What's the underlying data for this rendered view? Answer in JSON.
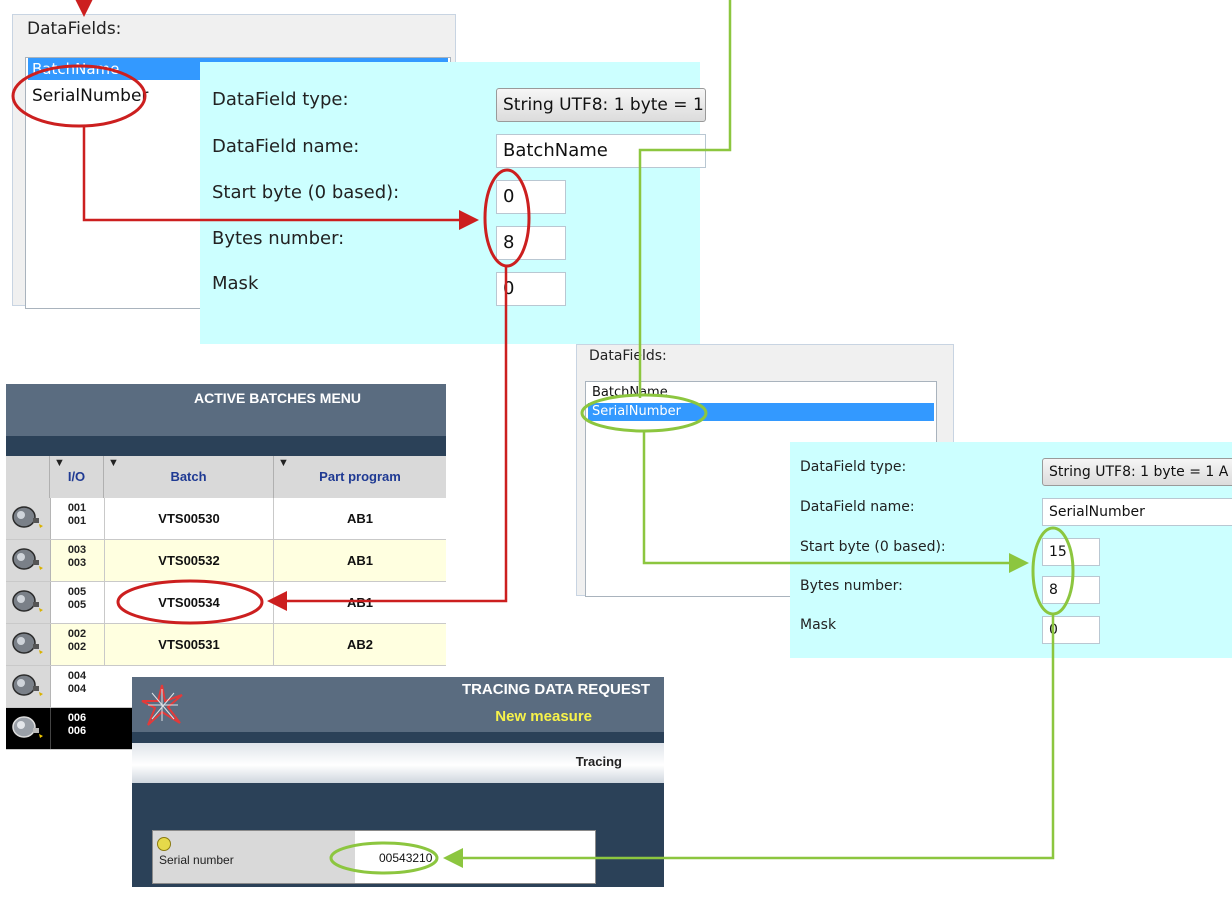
{
  "panel_top": {
    "group_title": "DataFields:",
    "list_items": [
      "BatchName",
      "SerialNumber"
    ],
    "selected_index": 0,
    "labels": {
      "type": "DataField type:",
      "name": "DataField name:",
      "start": "Start byte (0 based):",
      "bytes": "Bytes number:",
      "mask": "Mask"
    },
    "values": {
      "type": "String UTF8: 1 byte = 1",
      "name": "BatchName",
      "start": "0",
      "bytes": "8",
      "mask": "0"
    }
  },
  "panel_right": {
    "group_title": "DataFields:",
    "list_items": [
      "BatchName",
      "SerialNumber"
    ],
    "selected_index": 1,
    "labels": {
      "type": "DataField type:",
      "name": "DataField name:",
      "start": "Start byte (0 based):",
      "bytes": "Bytes number:",
      "mask": "Mask"
    },
    "values": {
      "type": "String UTF8: 1 byte = 1 A",
      "name": "SerialNumber",
      "start": "15",
      "bytes": "8",
      "mask": "0"
    }
  },
  "batches_menu": {
    "title": "ACTIVE BATCHES MENU",
    "columns": {
      "io": "I/O",
      "batch": "Batch",
      "program": "Part program"
    },
    "rows": [
      {
        "io_top": "001",
        "io_bottom": "001",
        "batch": "VTS00530",
        "program": "AB1"
      },
      {
        "io_top": "003",
        "io_bottom": "003",
        "batch": "VTS00532",
        "program": "AB1"
      },
      {
        "io_top": "005",
        "io_bottom": "005",
        "batch": "VTS00534",
        "program": "AB1"
      },
      {
        "io_top": "002",
        "io_bottom": "002",
        "batch": "VTS00531",
        "program": "AB2"
      },
      {
        "io_top": "004",
        "io_bottom": "004",
        "batch": "",
        "program": ""
      },
      {
        "io_top": "006",
        "io_bottom": "006",
        "batch": "",
        "program": ""
      }
    ]
  },
  "tracing": {
    "title": "TRACING DATA REQUEST",
    "subtitle": "New measure",
    "tab": "Tracing",
    "serial_label": "Serial number",
    "serial_value": "00543210"
  },
  "colors": {
    "red_annotation": "#cc1f1f",
    "green_annotation": "#8cc63f",
    "cyan_panel": "#ccffff",
    "selection_blue": "#3399ff",
    "menu_header": "#5a6c80",
    "menu_dark": "#2b4158",
    "row_alt": "#ffffe0",
    "row_selected": "#000000",
    "subtitle_yellow": "#f7f24a"
  }
}
